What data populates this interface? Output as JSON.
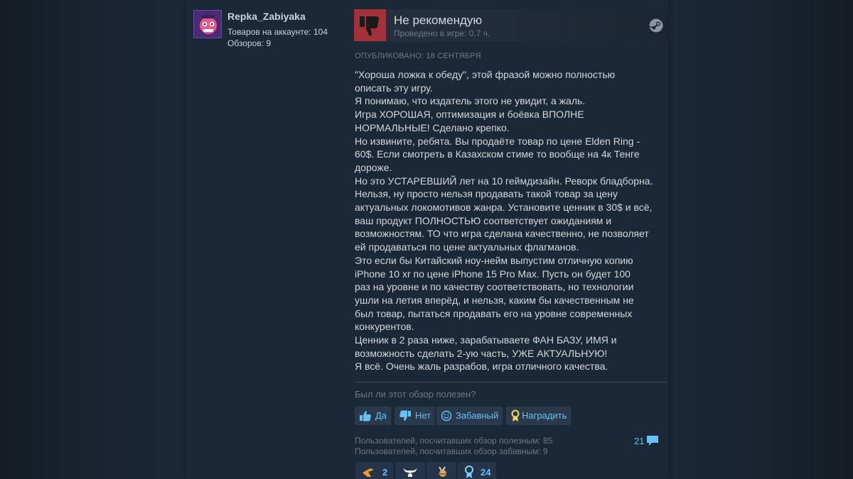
{
  "author": {
    "name": "Repka_Zabiyaka",
    "products": "Товаров на аккаунте: 104",
    "reviews": "Обзоров: 9"
  },
  "review": {
    "verdict": "Не рекомендую",
    "hours": "Проведено в игре: 0.7 ч.",
    "posted": "ОПУБЛИКОВАНО: 18 СЕНТЯБРЯ",
    "lines": [
      "\"Хороша ложка к обеду\", этой фразой можно полностью",
      "описать эту игру.",
      "Я понимаю, что издатель этого не увидит, а жаль.",
      "Игра ХОРОШАЯ, оптимизация и боёвка ВПОЛНЕ",
      "НОРМАЛЬНЫЕ! Сделано крепко.",
      "Но извините, ребята. Вы продаёте товар по цене Elden Ring -",
      "60$. Если смотреть в Казахском стиме то вообще на 4к Тенге",
      "дороже.",
      "Но это УСТАРЕВШИЙ лет на 10 геймдизайн. Реворк бладборна.",
      "Нельзя, ну просто нельзя продавать такой товар за цену",
      "актуальных локомотивов жанра. Установите ценник в 30$ и всё,",
      "ваш продукт ПОЛНОСТЬЮ соответствует ожиданиям и",
      "возможностям. ТО что игра сделана качественно, не позволяет",
      "ей продаваться по цене актуальных флагманов.",
      "Это если бы Китайский ноу-нейм выпустим отличную копию",
      "iPhone 10 xr по цене iPhone 15 Pro Max. Пусть он будет 100",
      "раз на уровне и по качеству соответствовать, но технологии",
      "ушли на летия вперёд, и нельзя, каким бы качественным не",
      "был товар, пытаться продавать его на уровне современных",
      "конкурентов.",
      "Ценник в 2 раза ниже, зарабатываете ФАН БАЗУ, ИМЯ и",
      "возможность сделать 2-ую часть, УЖЕ АКТУАЛЬНУЮ!",
      "Я всё. Очень жаль разрабов, игра отличного качества."
    ]
  },
  "feedback": {
    "question": "Был ли этот обзор полезен?",
    "yes": "Да",
    "no": "Нет",
    "funny": "Забавный",
    "award": "Наградить"
  },
  "stats": {
    "helpful": "Пользователей, посчитавших обзор полезным: 85",
    "funny": "Пользователей, посчитавших обзор забавным: 9",
    "comments": "21"
  },
  "awards": [
    {
      "icon": "boomerang-icon",
      "count": "2"
    },
    {
      "icon": "cow-icon",
      "count": ""
    },
    {
      "icon": "deer-icon",
      "count": ""
    },
    {
      "icon": "medal-icon",
      "count": "24"
    }
  ],
  "colors": {
    "accent": "#67c1f5",
    "not_recommended": "#a3313a",
    "text": "#d6d7d8",
    "muted": "#6d7886"
  }
}
